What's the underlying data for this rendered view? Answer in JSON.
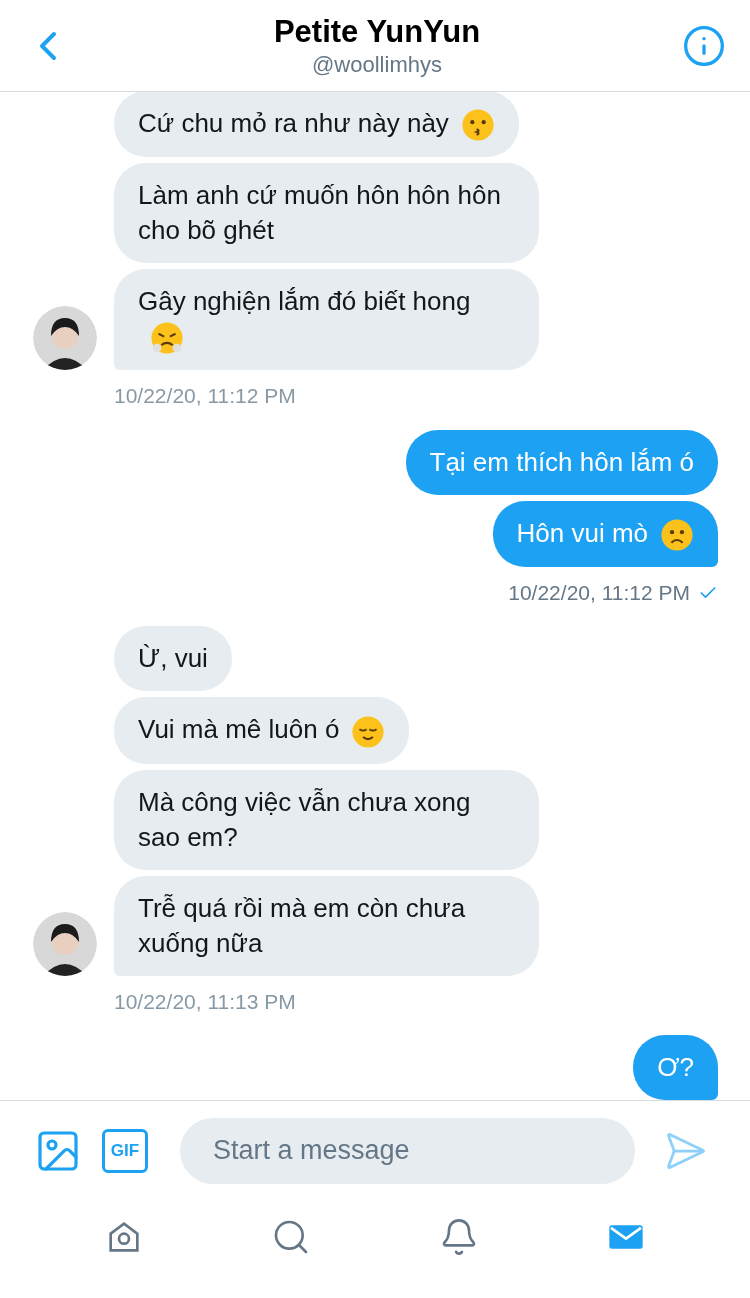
{
  "header": {
    "title": "Petite YunYun",
    "handle": "@woollimhys"
  },
  "groups": [
    {
      "kind": "received",
      "timestamp": "10/22/20, 11:12 PM",
      "delivered": false,
      "messages": [
        {
          "text": "Cứ chu mỏ ra như này này",
          "kind": "kissing"
        },
        {
          "text": "Làm anh cứ muốn hôn hôn hôn cho bõ ghét",
          "kind": "plain"
        },
        {
          "text": "Gây nghiện lắm đó biết hong",
          "kind": "steam"
        }
      ]
    },
    {
      "kind": "sent",
      "timestamp": "10/22/20, 11:12 PM",
      "delivered": true,
      "messages": [
        {
          "text": "Tại em thích hôn lắm ó",
          "kind": "plain"
        },
        {
          "text": "Hôn vui mò",
          "kind": "frown"
        }
      ]
    },
    {
      "kind": "received",
      "timestamp": "10/22/20, 11:13 PM",
      "delivered": false,
      "messages": [
        {
          "text": "Ừ, vui",
          "kind": "plain"
        },
        {
          "text": "Vui mà mê luôn ó",
          "kind": "relieved"
        },
        {
          "text": "Mà công việc vẫn chưa xong sao em?",
          "kind": "plain"
        },
        {
          "text": "Trễ quá rồi mà em còn chưa xuống nữa",
          "kind": "plain"
        }
      ]
    },
    {
      "kind": "sent",
      "messages": [
        {
          "text": "Ơ?",
          "kind": "plain"
        }
      ]
    }
  ],
  "composer": {
    "gif_label": "GIF",
    "placeholder": "Start a message"
  },
  "nav": [
    {
      "selected": false
    },
    {
      "selected": false
    },
    {
      "selected": false
    },
    {
      "selected": true
    }
  ]
}
